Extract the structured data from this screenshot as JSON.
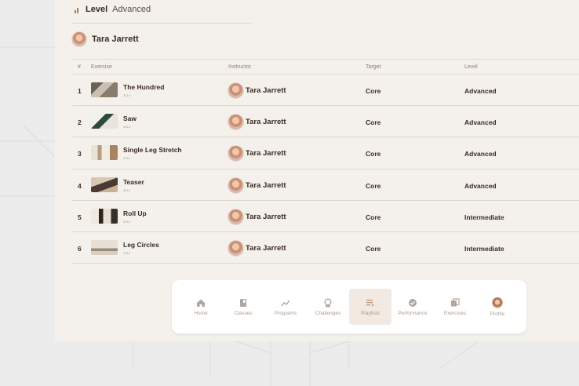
{
  "header": {
    "level_label": "Level",
    "level_value": "Advanced"
  },
  "author": {
    "name": "Tara Jarrett"
  },
  "table": {
    "columns": [
      "#",
      "Exercise",
      "Instructor",
      "Target",
      "Level"
    ],
    "rows": [
      {
        "num": "1",
        "exercise": "The Hundred",
        "duration": "3214",
        "instructor": "Tara Jarrett",
        "target": "Core",
        "level": "Advanced"
      },
      {
        "num": "2",
        "exercise": "Saw",
        "duration": "3214",
        "instructor": "Tara Jarrett",
        "target": "Core",
        "level": "Advanced"
      },
      {
        "num": "3",
        "exercise": "Single Leg Stretch",
        "duration": "3214",
        "instructor": "Tara Jarrett",
        "target": "Core",
        "level": "Advanced"
      },
      {
        "num": "4",
        "exercise": "Teaser",
        "duration": "3214",
        "instructor": "Tara Jarrett",
        "target": "Core",
        "level": "Advanced"
      },
      {
        "num": "5",
        "exercise": "Roll Up",
        "duration": "3214",
        "instructor": "Tara Jarrett",
        "target": "Core",
        "level": "Intermediate"
      },
      {
        "num": "6",
        "exercise": "Leg Circles",
        "duration": "3214",
        "instructor": "Tara Jarrett",
        "target": "Core",
        "level": "Intermediate"
      }
    ]
  },
  "nav": {
    "items": [
      {
        "label": "Home",
        "icon": "home-icon"
      },
      {
        "label": "Classes",
        "icon": "book-icon"
      },
      {
        "label": "Programs",
        "icon": "trend-icon"
      },
      {
        "label": "Challenges",
        "icon": "award-icon"
      },
      {
        "label": "Playlists",
        "icon": "playlist-icon",
        "active": true
      },
      {
        "label": "Performance",
        "icon": "badge-check-icon"
      },
      {
        "label": "Exercises",
        "icon": "stack-icon"
      },
      {
        "label": "Profile",
        "icon": "profile-avatar"
      }
    ]
  },
  "colors": {
    "accent": "#c0957a",
    "panel_bg": "#f4f1ec",
    "text_dark": "#3a2a22"
  }
}
